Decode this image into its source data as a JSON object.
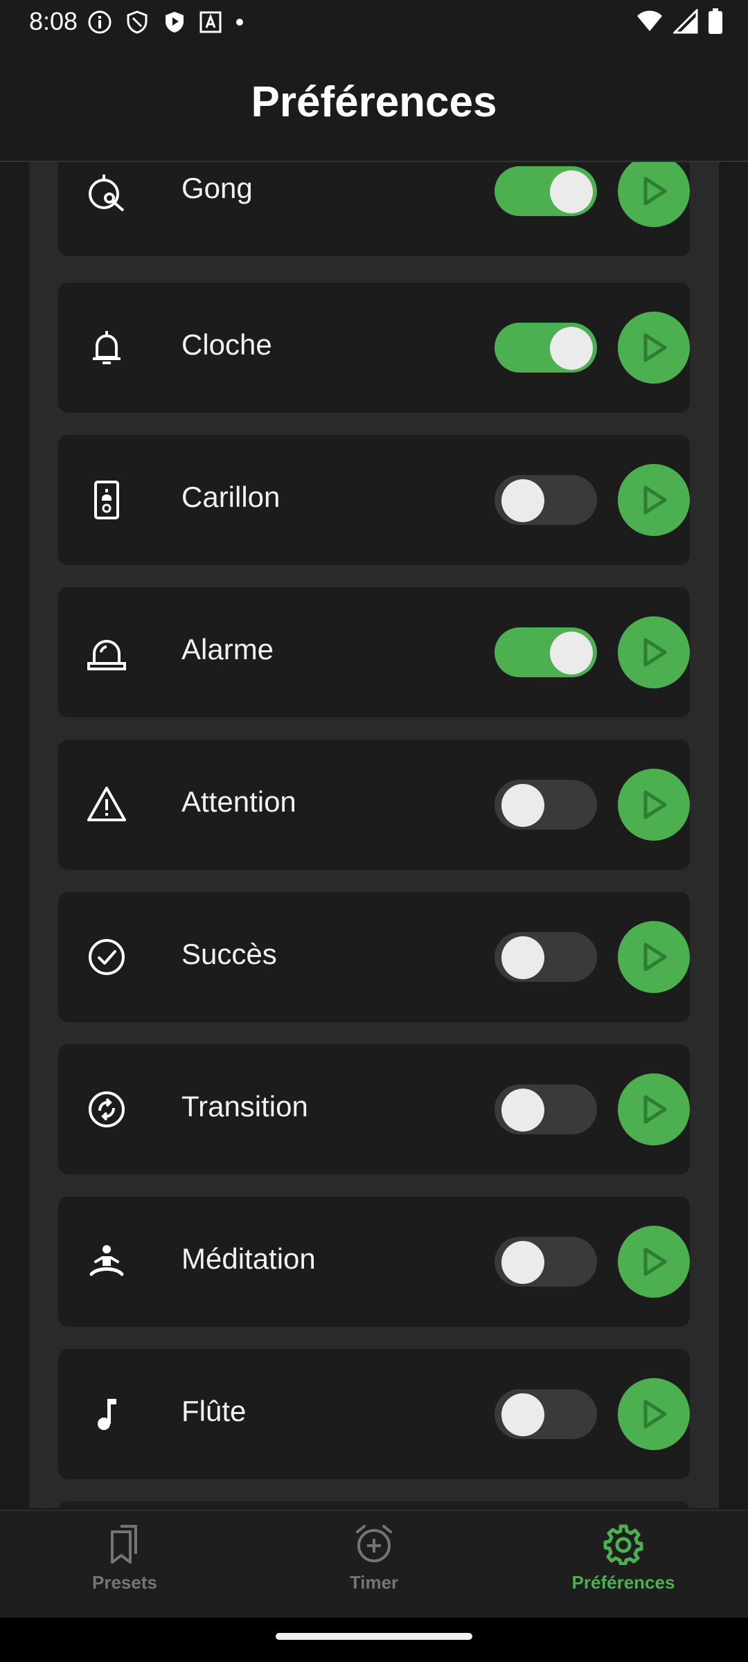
{
  "status_bar": {
    "time": "8:08"
  },
  "header": {
    "title": "Préférences"
  },
  "sounds": [
    {
      "label": "Gong",
      "icon": "gong-icon",
      "enabled": true
    },
    {
      "label": "Cloche",
      "icon": "bell-icon",
      "enabled": true
    },
    {
      "label": "Carillon",
      "icon": "doorbell-icon",
      "enabled": false
    },
    {
      "label": "Alarme",
      "icon": "alarm-light-icon",
      "enabled": true
    },
    {
      "label": "Attention",
      "icon": "warning-icon",
      "enabled": false
    },
    {
      "label": "Succès",
      "icon": "check-circle-icon",
      "enabled": false
    },
    {
      "label": "Transition",
      "icon": "sync-icon",
      "enabled": false
    },
    {
      "label": "Méditation",
      "icon": "meditation-icon",
      "enabled": false
    },
    {
      "label": "Flûte",
      "icon": "music-note-icon",
      "enabled": false
    }
  ],
  "bottom_nav": {
    "items": [
      {
        "label": "Presets",
        "icon": "bookmarks-icon",
        "active": false
      },
      {
        "label": "Timer",
        "icon": "alarm-add-icon",
        "active": false
      },
      {
        "label": "Préférences",
        "icon": "settings-gear-icon",
        "active": true
      }
    ]
  },
  "colors": {
    "accent": "#4caf50",
    "background": "#1a1a1a",
    "card": "#1c1c1c",
    "inactive": "#757575"
  }
}
